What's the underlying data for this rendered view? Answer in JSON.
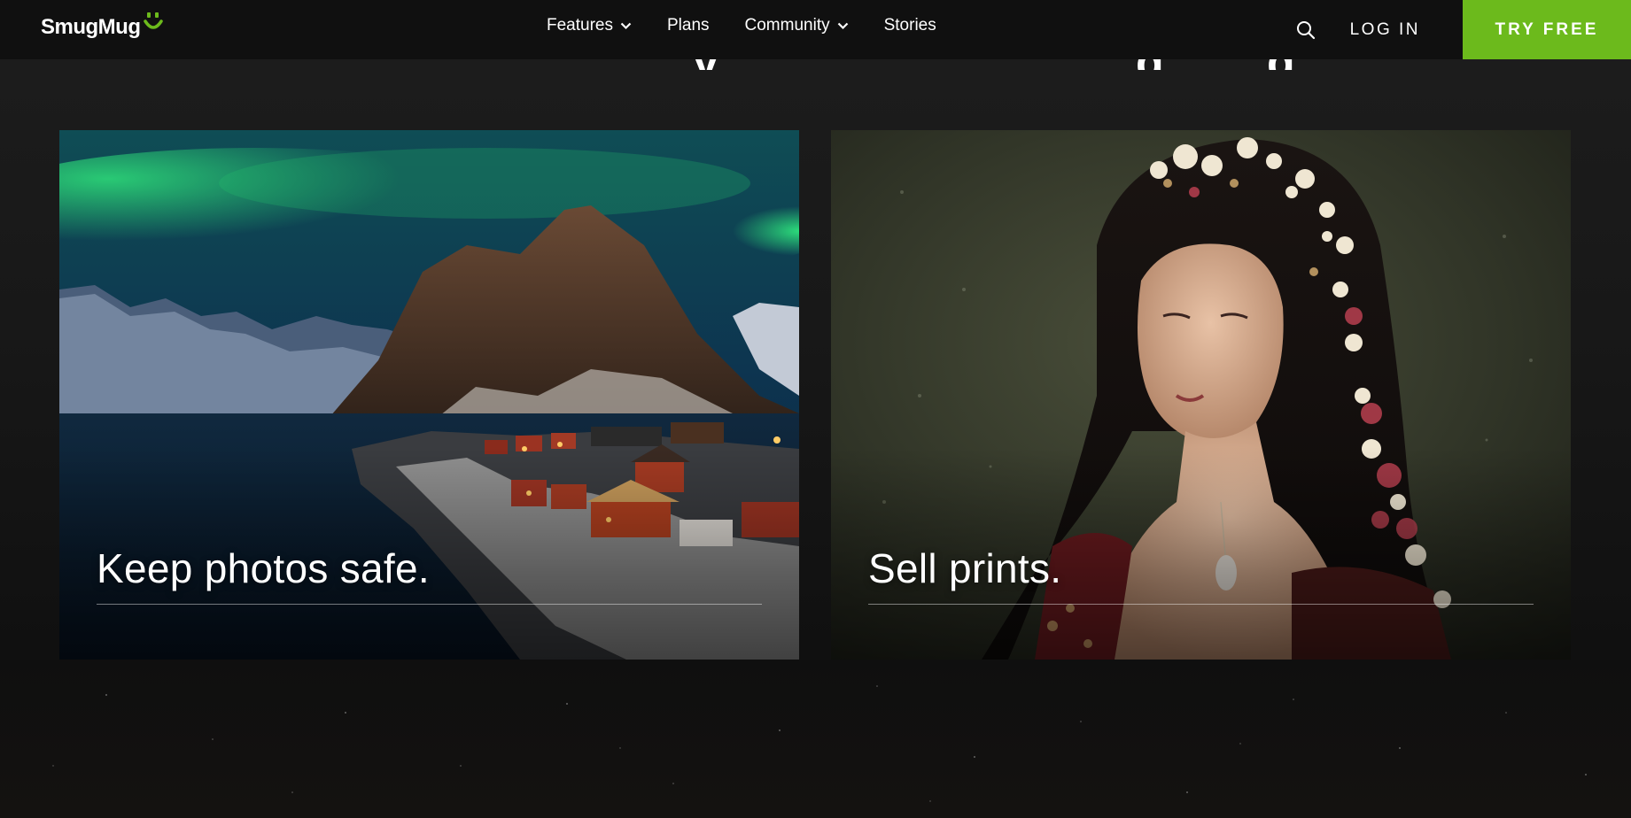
{
  "brand": {
    "name": "SmugMug",
    "accent": "#6cba1c"
  },
  "nav": {
    "items": [
      {
        "label": "Features",
        "has_dropdown": true
      },
      {
        "label": "Plans",
        "has_dropdown": false
      },
      {
        "label": "Community",
        "has_dropdown": true
      },
      {
        "label": "Stories",
        "has_dropdown": false
      }
    ],
    "search_icon": "search-icon",
    "login_label": "LOG IN",
    "cta_label": "TRY FREE"
  },
  "cards": [
    {
      "title": "Keep photos safe.",
      "image": "aurora-fishing-village"
    },
    {
      "title": "Sell prints.",
      "image": "floral-crown-portrait"
    }
  ],
  "colors": {
    "background": "#141414",
    "nav_background": "#101010",
    "cta": "#6cba1c"
  }
}
